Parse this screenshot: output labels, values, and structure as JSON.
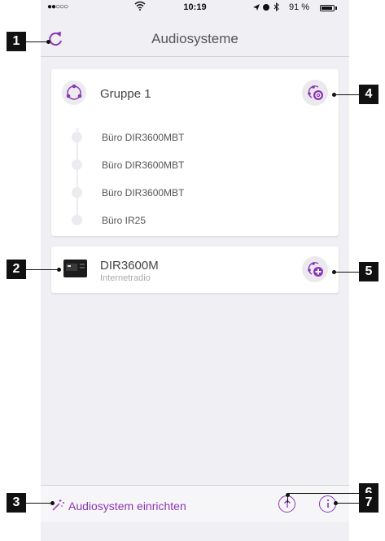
{
  "status": {
    "signal": "●●○○○",
    "time": "10:19",
    "battery_text": "91 %"
  },
  "nav": {
    "title": "Audiosysteme"
  },
  "group": {
    "name": "Gruppe 1",
    "members": [
      "Büro DIR3600MBT",
      "Büro DIR3600MBT",
      "Büro DIR3600MBT",
      "Büro IR25"
    ]
  },
  "device": {
    "name": "DIR3600M",
    "subtitle": "Internetradio"
  },
  "bottom": {
    "setup_label": "Audiosystem einrichten"
  },
  "callouts": [
    "1",
    "2",
    "3",
    "4",
    "5",
    "6",
    "7"
  ],
  "colors": {
    "accent": "#8e35b4",
    "background": "#efeff4"
  }
}
